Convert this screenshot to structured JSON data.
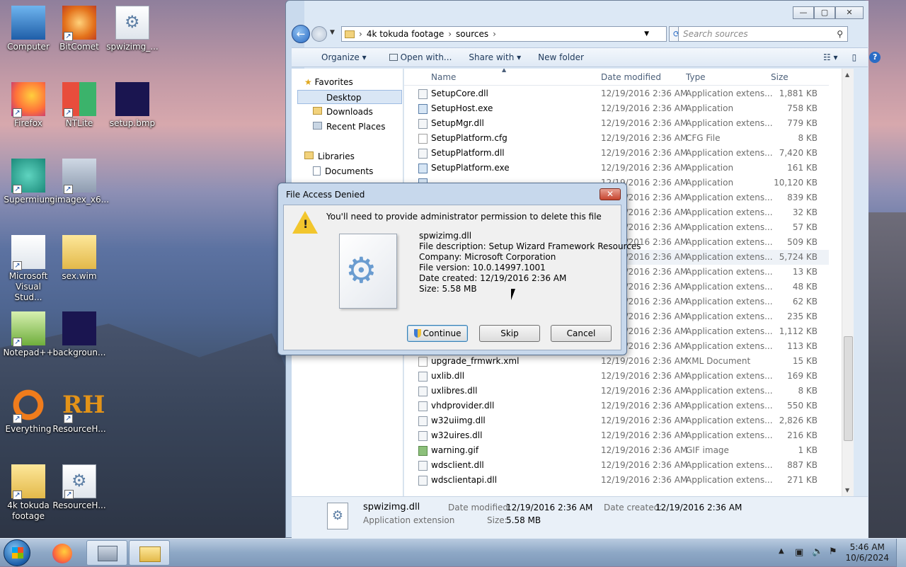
{
  "desktop": {
    "icons": [
      {
        "label": "Computer"
      },
      {
        "label": "BitComet"
      },
      {
        "label": "spwizimg_..."
      },
      {
        "label": "Firefox"
      },
      {
        "label": "NTLite"
      },
      {
        "label": "setup.bmp"
      },
      {
        "label": "Supermium"
      },
      {
        "label": "gimagex_x6..."
      },
      {
        "label": "Microsoft Visual Stud..."
      },
      {
        "label": "sex.wim"
      },
      {
        "label": "Notepad++"
      },
      {
        "label": "backgroun..."
      },
      {
        "label": "Everything"
      },
      {
        "label": "ResourceH..."
      },
      {
        "label": "4k tokuda footage"
      },
      {
        "label": "ResourceH..."
      }
    ]
  },
  "explorer": {
    "window_controls": {
      "minimize": "—",
      "maximize": "▢",
      "close": "✕"
    },
    "breadcrumb": [
      "4k tokuda footage",
      "sources"
    ],
    "search_placeholder": "Search sources",
    "toolbar": {
      "organize": "Organize ▾",
      "open_with": "Open with...",
      "share_with": "Share with ▾",
      "new_folder": "New folder"
    },
    "nav": {
      "favorites": "Favorites",
      "desktop": "Desktop",
      "downloads": "Downloads",
      "recent": "Recent Places",
      "libraries": "Libraries",
      "documents": "Documents"
    },
    "columns": {
      "name": "Name",
      "date": "Date modified",
      "type": "Type",
      "size": "Size"
    },
    "files": [
      {
        "name": "SetupCore.dll",
        "date": "12/19/2016 2:36 AM",
        "type": "Application extens...",
        "size": "1,881 KB",
        "icon": "dll"
      },
      {
        "name": "SetupHost.exe",
        "date": "12/19/2016 2:36 AM",
        "type": "Application",
        "size": "758 KB",
        "icon": "exe"
      },
      {
        "name": "SetupMgr.dll",
        "date": "12/19/2016 2:36 AM",
        "type": "Application extens...",
        "size": "779 KB",
        "icon": "dll"
      },
      {
        "name": "SetupPlatform.cfg",
        "date": "12/19/2016 2:36 AM",
        "type": "CFG File",
        "size": "8 KB",
        "icon": "cfg"
      },
      {
        "name": "SetupPlatform.dll",
        "date": "12/19/2016 2:36 AM",
        "type": "Application extens...",
        "size": "7,420 KB",
        "icon": "dll"
      },
      {
        "name": "SetupPlatform.exe",
        "date": "12/19/2016 2:36 AM",
        "type": "Application",
        "size": "161 KB",
        "icon": "exe"
      },
      {
        "name": "",
        "date": "12/19/2016 2:36 AM",
        "type": "Application",
        "size": "10,120 KB",
        "icon": "exe"
      },
      {
        "name": "",
        "date": "12/19/2016 2:36 AM",
        "type": "Application extens...",
        "size": "839 KB",
        "icon": "dll"
      },
      {
        "name": "",
        "date": "12/19/2016 2:36 AM",
        "type": "Application extens...",
        "size": "32 KB",
        "icon": "dll"
      },
      {
        "name": "",
        "date": "12/19/2016 2:36 AM",
        "type": "Application extens...",
        "size": "57 KB",
        "icon": "dll"
      },
      {
        "name": "",
        "date": "12/19/2016 2:36 AM",
        "type": "Application extens...",
        "size": "509 KB",
        "icon": "dll"
      },
      {
        "name": "",
        "date": "12/19/2016 2:36 AM",
        "type": "Application extens...",
        "size": "5,724 KB",
        "icon": "dll"
      },
      {
        "name": "",
        "date": "12/19/2016 2:36 AM",
        "type": "Application extens...",
        "size": "13 KB",
        "icon": "dll"
      },
      {
        "name": "",
        "date": "12/19/2016 2:36 AM",
        "type": "Application extens...",
        "size": "48 KB",
        "icon": "dll"
      },
      {
        "name": "",
        "date": "12/19/2016 2:36 AM",
        "type": "Application extens...",
        "size": "62 KB",
        "icon": "dll"
      },
      {
        "name": "",
        "date": "12/19/2016 2:36 AM",
        "type": "Application extens...",
        "size": "235 KB",
        "icon": "dll"
      },
      {
        "name": "",
        "date": "12/19/2016 2:36 AM",
        "type": "Application extens...",
        "size": "1,112 KB",
        "icon": "dll"
      },
      {
        "name": "",
        "date": "12/19/2016 2:36 AM",
        "type": "Application extens...",
        "size": "113 KB",
        "icon": "dll"
      },
      {
        "name": "upgrade_frmwrk.xml",
        "date": "12/19/2016 2:36 AM",
        "type": "XML Document",
        "size": "15 KB",
        "icon": "cfg"
      },
      {
        "name": "uxlib.dll",
        "date": "12/19/2016 2:36 AM",
        "type": "Application extens...",
        "size": "169 KB",
        "icon": "dll"
      },
      {
        "name": "uxlibres.dll",
        "date": "12/19/2016 2:36 AM",
        "type": "Application extens...",
        "size": "8 KB",
        "icon": "dll"
      },
      {
        "name": "vhdprovider.dll",
        "date": "12/19/2016 2:36 AM",
        "type": "Application extens...",
        "size": "550 KB",
        "icon": "dll"
      },
      {
        "name": "w32uiimg.dll",
        "date": "12/19/2016 2:36 AM",
        "type": "Application extens...",
        "size": "2,826 KB",
        "icon": "dll"
      },
      {
        "name": "w32uires.dll",
        "date": "12/19/2016 2:36 AM",
        "type": "Application extens...",
        "size": "216 KB",
        "icon": "dll"
      },
      {
        "name": "warning.gif",
        "date": "12/19/2016 2:36 AM",
        "type": "GIF image",
        "size": "1 KB",
        "icon": "img"
      },
      {
        "name": "wdsclient.dll",
        "date": "12/19/2016 2:36 AM",
        "type": "Application extens...",
        "size": "887 KB",
        "icon": "dll"
      },
      {
        "name": "wdsclientapi.dll",
        "date": "12/19/2016 2:36 AM",
        "type": "Application extens...",
        "size": "271 KB",
        "icon": "dll"
      }
    ],
    "details": {
      "name": "spwizimg.dll",
      "kind": "Application extension",
      "date_modified_label": "Date modified:",
      "date_modified": "12/19/2016 2:36 AM",
      "date_created_label": "Date created:",
      "date_created": "12/19/2016 2:36 AM",
      "size_label": "Size:",
      "size": "5.58 MB"
    }
  },
  "dialog": {
    "title": "File Access Denied",
    "close": "✕",
    "message": "You'll need to provide administrator permission to delete this file",
    "file_name": "spwizimg.dll",
    "description": "File description: Setup Wizard Framework Resources",
    "company": "Company: Microsoft Corporation",
    "version": "File version: 10.0.14997.1001",
    "created": "Date created: 12/19/2016 2:36 AM",
    "size": "Size: 5.58 MB",
    "buttons": {
      "continue": "Continue",
      "skip": "Skip",
      "cancel": "Cancel"
    }
  },
  "taskbar": {
    "time": "5:46 AM",
    "date": "10/6/2024"
  },
  "colors": {
    "accent": "#2a6cc5",
    "dialog_frame": "#c7d8ec",
    "warning": "#f2c62d"
  }
}
